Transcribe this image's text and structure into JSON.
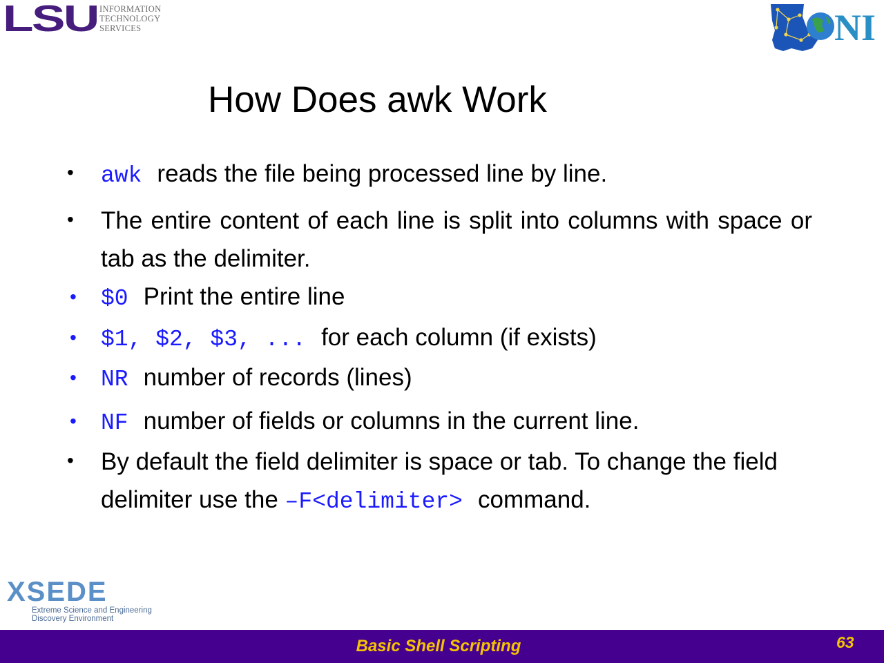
{
  "header": {
    "lsu_logo_text": "LSU",
    "its_lines": [
      "INFORMATION",
      "TECHNOLOGY",
      "SERVICES"
    ],
    "loni_logo_text": "NI"
  },
  "title": "How Does awk Work",
  "bullets": [
    {
      "code": "awk",
      "text": "reads the file being processed line by line."
    },
    {
      "text": "The entire content of each line is split into columns with space or tab as the delimiter."
    },
    {
      "code": "$0",
      "text": "Print the entire line"
    },
    {
      "code": "$1, $2, $3, ...",
      "text": "for each column (if exists)"
    },
    {
      "code": "NR",
      "text": "number of records (lines)"
    },
    {
      "code": "NF",
      "text": "number of fields or columns in the current line."
    },
    {
      "text_before": "By default the field delimiter is space or tab. To change the field delimiter use the",
      "code": "–F<delimiter>",
      "text_after": "command."
    }
  ],
  "footer": {
    "xsede_logo_text": "XSEDE",
    "xsede_tagline_1": "Extreme Science and Engineering",
    "xsede_tagline_2": "Discovery Environment",
    "title": "Basic Shell Scripting",
    "page_number": "63"
  },
  "colors": {
    "lsu_purple": "#461d7c",
    "footer_bar": "#460090",
    "footer_text": "#f5c400",
    "code_blue": "#1a1aff"
  }
}
